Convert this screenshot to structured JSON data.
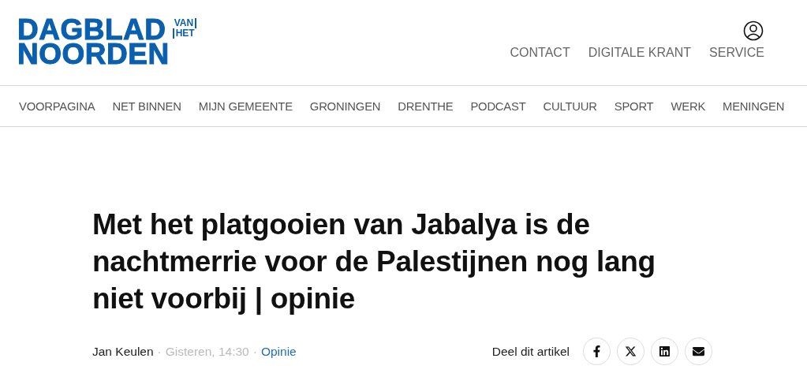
{
  "logo": {
    "lines": [
      "DAGBLAD",
      "NOORDEN"
    ],
    "small": [
      "VAN",
      "HET"
    ]
  },
  "top_links": [
    "CONTACT",
    "DIGITALE KRANT",
    "SERVICE"
  ],
  "nav": [
    "VOORPAGINA",
    "NET BINNEN",
    "MIJN GEMEENTE",
    "GRONINGEN",
    "DRENTHE",
    "PODCAST",
    "CULTUUR",
    "SPORT",
    "WERK",
    "MENINGEN"
  ],
  "article": {
    "title": "Met het platgooien van Jabalya is de nachtmerrie voor de Palestijnen nog lang niet voorbij | opinie",
    "author": "Jan Keulen",
    "separator": "·",
    "date": "Gisteren, 14:30",
    "category": "Opinie",
    "share_label": "Deel dit artikel",
    "share": [
      {
        "kind": "facebook"
      },
      {
        "kind": "x"
      },
      {
        "kind": "linkedin"
      },
      {
        "kind": "email"
      }
    ]
  }
}
